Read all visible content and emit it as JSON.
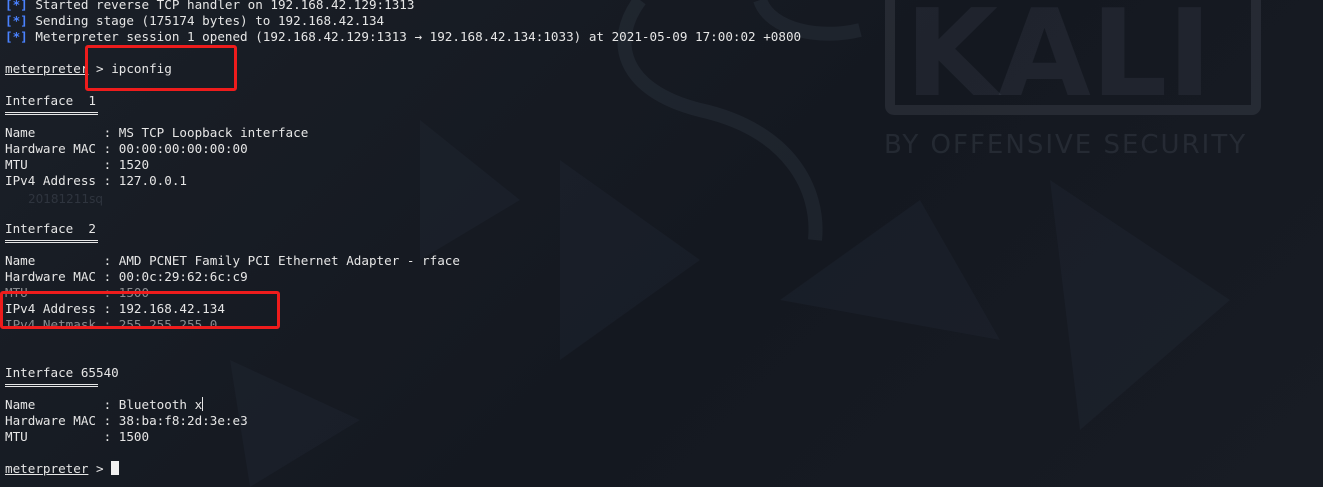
{
  "watermark": {
    "brand": "KALI",
    "tagline": "BY OFFENSIVE SECURITY",
    "desktop_label": "20181211sq"
  },
  "log": [
    {
      "marker": "[*]",
      "text": "Started reverse TCP handler on 192.168.42.129:1313"
    },
    {
      "marker": "[*]",
      "text": "Sending stage (175174 bytes) to 192.168.42.134"
    },
    {
      "marker": "[*]",
      "text": "Meterpreter session 1 opened (192.168.42.129:1313 → 192.168.42.134:1033) at 2021-05-09 17:00:02 +0800"
    }
  ],
  "prompt": {
    "label": "meterpreter",
    "symbol": ">",
    "command": "ipconfig"
  },
  "interfaces": [
    {
      "header": "Interface  1",
      "rows": [
        {
          "key": "Name         ",
          "value": "MS TCP Loopback interface"
        },
        {
          "key": "Hardware MAC ",
          "value": "00:00:00:00:00:00"
        },
        {
          "key": "MTU          ",
          "value": "1520"
        },
        {
          "key": "IPv4 Address ",
          "value": "127.0.0.1"
        }
      ]
    },
    {
      "header": "Interface  2",
      "rows": [
        {
          "key": "Name         ",
          "value": "AMD PCNET Family PCI Ethernet Adapter - rface"
        },
        {
          "key": "Hardware MAC ",
          "value": "00:0c:29:62:6c:c9"
        },
        {
          "key": "MTU          ",
          "value": "1500"
        },
        {
          "key": "IPv4 Address ",
          "value": "192.168.42.134"
        },
        {
          "key": "IPv4 Netmask ",
          "value": "255.255.255.0"
        }
      ]
    },
    {
      "header": "Interface 65540",
      "rows": [
        {
          "key": "Name         ",
          "value": "Bluetooth x"
        },
        {
          "key": "Hardware MAC ",
          "value": "38:ba:f8:2d:3e:e3"
        },
        {
          "key": "MTU          ",
          "value": "1500"
        }
      ]
    }
  ],
  "colors": {
    "background": "#171b22",
    "text": "#e6e6e6",
    "marker_blue": "#4a82ff",
    "highlight_red": "#ee1c1c"
  }
}
